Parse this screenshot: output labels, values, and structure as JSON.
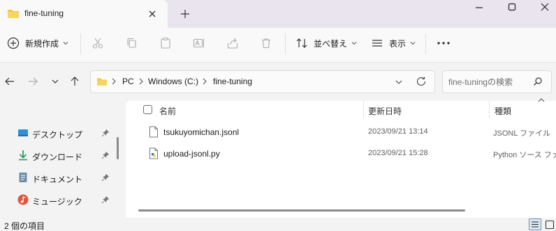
{
  "window": {
    "tab_title": "fine-tuning",
    "icons": {
      "folder": "folder-icon",
      "close": "close-icon",
      "add": "plus-icon",
      "minimize": "minimize-icon",
      "maximize": "maximize-icon"
    }
  },
  "toolbar": {
    "new_label": "新規作成",
    "sort_label": "並べ替え",
    "view_label": "表示",
    "icons": [
      "add-circle-icon",
      "cut-icon",
      "copy-icon",
      "paste-icon",
      "rename-icon",
      "share-icon",
      "delete-icon",
      "sort-icon",
      "view-icon",
      "more-icon"
    ]
  },
  "address": {
    "breadcrumb": [
      "PC",
      "Windows (C:)",
      "fine-tuning"
    ],
    "search_placeholder": "fine-tuningの検索"
  },
  "sidebar": {
    "items": [
      {
        "label": "デスクトップ",
        "icon": "desktop-icon",
        "color": "#2f8fd8"
      },
      {
        "label": "ダウンロード",
        "icon": "download-icon",
        "color": "#2a9d5c"
      },
      {
        "label": "ドキュメント",
        "icon": "document-icon",
        "color": "#6f8fa8"
      },
      {
        "label": "ミュージック",
        "icon": "music-icon",
        "color": "#e0553b"
      }
    ]
  },
  "file_list": {
    "columns": [
      "名前",
      "更新日時",
      "種類"
    ],
    "files": [
      {
        "name": "tsukuyomichan.jsonl",
        "modified": "2023/09/21 13:14",
        "type": "JSONL ファイル",
        "icon": "file-icon"
      },
      {
        "name": "upload-jsonl.py",
        "modified": "2023/09/21 15:28",
        "type": "Python ソース ファイル",
        "icon": "python-file-icon"
      }
    ]
  },
  "status": {
    "item_count": "2 個の項目"
  },
  "colors": {
    "accent": "#0067c0",
    "folder": "#f4c542",
    "titlebar": "#e9e4ee"
  }
}
